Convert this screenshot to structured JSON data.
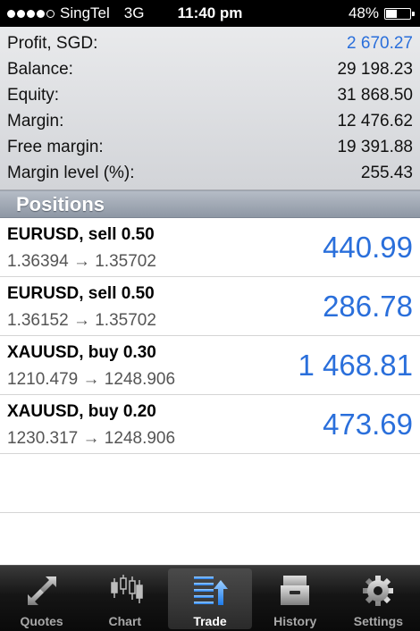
{
  "status_bar": {
    "carrier": "SingTel",
    "network": "3G",
    "time": "11:40 pm",
    "battery": "48%",
    "battery_level": 0.48,
    "signal_bars": 4
  },
  "account": {
    "rows": [
      {
        "label": "Profit, SGD:",
        "value": "2 670.27"
      },
      {
        "label": "Balance:",
        "value": "29 198.23"
      },
      {
        "label": "Equity:",
        "value": "31 868.50"
      },
      {
        "label": "Margin:",
        "value": "12 476.62"
      },
      {
        "label": "Free margin:",
        "value": "19 391.88"
      },
      {
        "label": "Margin level (%):",
        "value": "255.43"
      }
    ]
  },
  "positions": {
    "header": "Positions",
    "items": [
      {
        "symbol": "EURUSD, sell 0.50",
        "prices": "1.36394 → 1.35702",
        "profit": "440.99"
      },
      {
        "symbol": "EURUSD, sell 0.50",
        "prices": "1.36152 → 1.35702",
        "profit": "286.78"
      },
      {
        "symbol": "XAUUSD, buy 0.30",
        "prices": "1210.479 → 1248.906",
        "profit": "1 468.81"
      },
      {
        "symbol": "XAUUSD, buy 0.20",
        "prices": "1230.317 → 1248.906",
        "profit": "473.69"
      }
    ]
  },
  "tabbar": {
    "tabs": [
      {
        "label": "Quotes",
        "icon": "quotes-icon"
      },
      {
        "label": "Chart",
        "icon": "chart-icon"
      },
      {
        "label": "Trade",
        "icon": "trade-icon",
        "active": true
      },
      {
        "label": "History",
        "icon": "history-icon"
      },
      {
        "label": "Settings",
        "icon": "settings-icon"
      }
    ]
  },
  "colors": {
    "accent": "#2a6fdb",
    "tabbar_bg": "#151515"
  }
}
